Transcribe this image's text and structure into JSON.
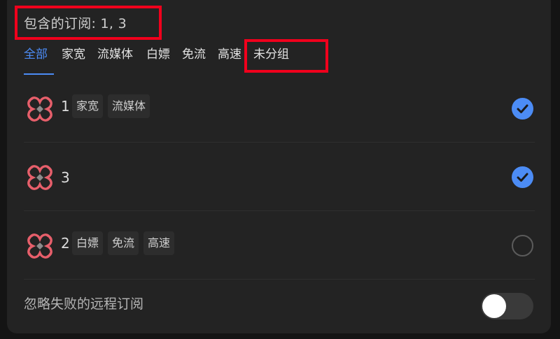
{
  "header": {
    "included_text": "包含的订阅: 1, 3"
  },
  "tabs": [
    {
      "label": "全部"
    },
    {
      "label": "家宽"
    },
    {
      "label": "流媒体"
    },
    {
      "label": "白嫖"
    },
    {
      "label": "免流"
    },
    {
      "label": "高速"
    },
    {
      "label": "未分组"
    }
  ],
  "subscriptions": [
    {
      "name": "1",
      "tags": [
        "家宽",
        "流媒体"
      ],
      "selected": true,
      "icon": "clash-logo-icon"
    },
    {
      "name": "3",
      "tags": [],
      "selected": true,
      "icon": "clash-logo-icon"
    },
    {
      "name": "2",
      "tags": [
        "白嫖",
        "免流",
        "高速"
      ],
      "selected": false,
      "icon": "clash-logo-icon"
    }
  ],
  "settings": {
    "ignore_failed_remote_label": "忽略失败的远程订阅",
    "ignore_failed_remote_enabled": false
  },
  "colors": {
    "accent": "#4c8cf5",
    "highlight": "#f0001c",
    "logo": "#e75f6b"
  }
}
